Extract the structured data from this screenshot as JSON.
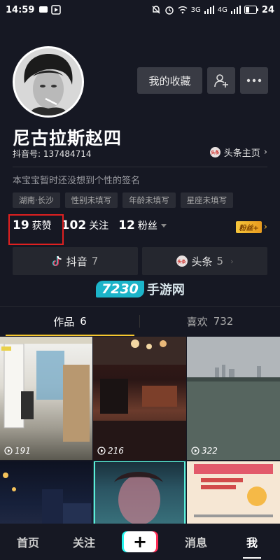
{
  "status_bar": {
    "time": "14:59",
    "battery": "24",
    "net1": "3G",
    "net2": "4G"
  },
  "profile": {
    "name": "尼古拉斯赵四",
    "douyin_id": "抖音号: 137484714",
    "toutiao_home": "头条主页",
    "signature": "本宝宝暂时还没想到个性的签名",
    "tags": [
      "湖南·长沙",
      "性别未填写",
      "年龄未填写",
      "星座未填写"
    ],
    "buttons": {
      "favorites": "我的收藏"
    }
  },
  "stats": {
    "likes_num": "19",
    "likes_label": "获赞",
    "following_num": "102",
    "following_label": "关注",
    "fans_num": "12",
    "fans_label": "粉丝",
    "fans_badge": "粉丝+"
  },
  "platforms": [
    {
      "name": "抖音",
      "count": "7"
    },
    {
      "name": "头条",
      "count": "5"
    }
  ],
  "watermark": {
    "number": "7230",
    "text": "手游网"
  },
  "tabs": [
    {
      "label": "作品",
      "count": "6"
    },
    {
      "label": "喜欢",
      "count": "732"
    }
  ],
  "videos": [
    {
      "likes": "191"
    },
    {
      "likes": "216"
    },
    {
      "likes": "322"
    }
  ],
  "nav": {
    "home": "首页",
    "follow": "关注",
    "plus": "+",
    "messages": "消息",
    "me": "我"
  },
  "colors": {
    "background": "#161823",
    "accent": "#f7c72f",
    "highlight": "#e02020",
    "watermark": "#1cb4c9"
  },
  "icons": [
    "mute-icon",
    "alarm-icon",
    "wifi-icon",
    "signal-icon",
    "add-user-icon",
    "more-icon",
    "douyin-logo-icon",
    "toutiao-badge-icon",
    "play-icon",
    "chevron-right-icon"
  ]
}
